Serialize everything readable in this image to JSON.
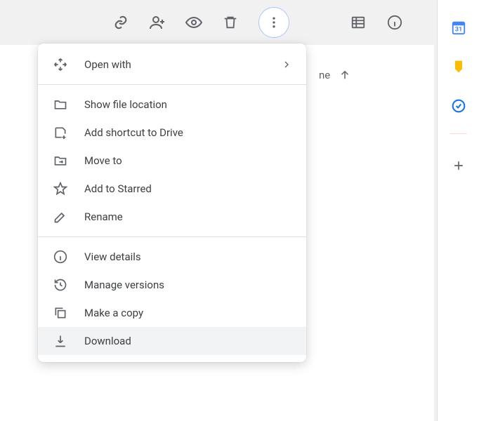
{
  "toolbar": {
    "icons": [
      "link",
      "person-add",
      "preview",
      "trash",
      "more",
      "list-view",
      "info"
    ]
  },
  "behind": {
    "text_fragment": "ne"
  },
  "side_panel": {
    "items": [
      "calendar",
      "keep",
      "tasks"
    ],
    "plus": "add"
  },
  "menu": {
    "sections": [
      [
        {
          "icon": "open-with",
          "label": "Open with",
          "submenu": true
        }
      ],
      [
        {
          "icon": "folder",
          "label": "Show file location"
        },
        {
          "icon": "shortcut-add",
          "label": "Add shortcut to Drive"
        },
        {
          "icon": "move",
          "label": "Move to"
        },
        {
          "icon": "star",
          "label": "Add to Starred"
        },
        {
          "icon": "rename",
          "label": "Rename"
        }
      ],
      [
        {
          "icon": "info",
          "label": "View details"
        },
        {
          "icon": "history",
          "label": "Manage versions"
        },
        {
          "icon": "copy",
          "label": "Make a copy"
        },
        {
          "icon": "download",
          "label": "Download",
          "hover": true
        }
      ]
    ]
  }
}
